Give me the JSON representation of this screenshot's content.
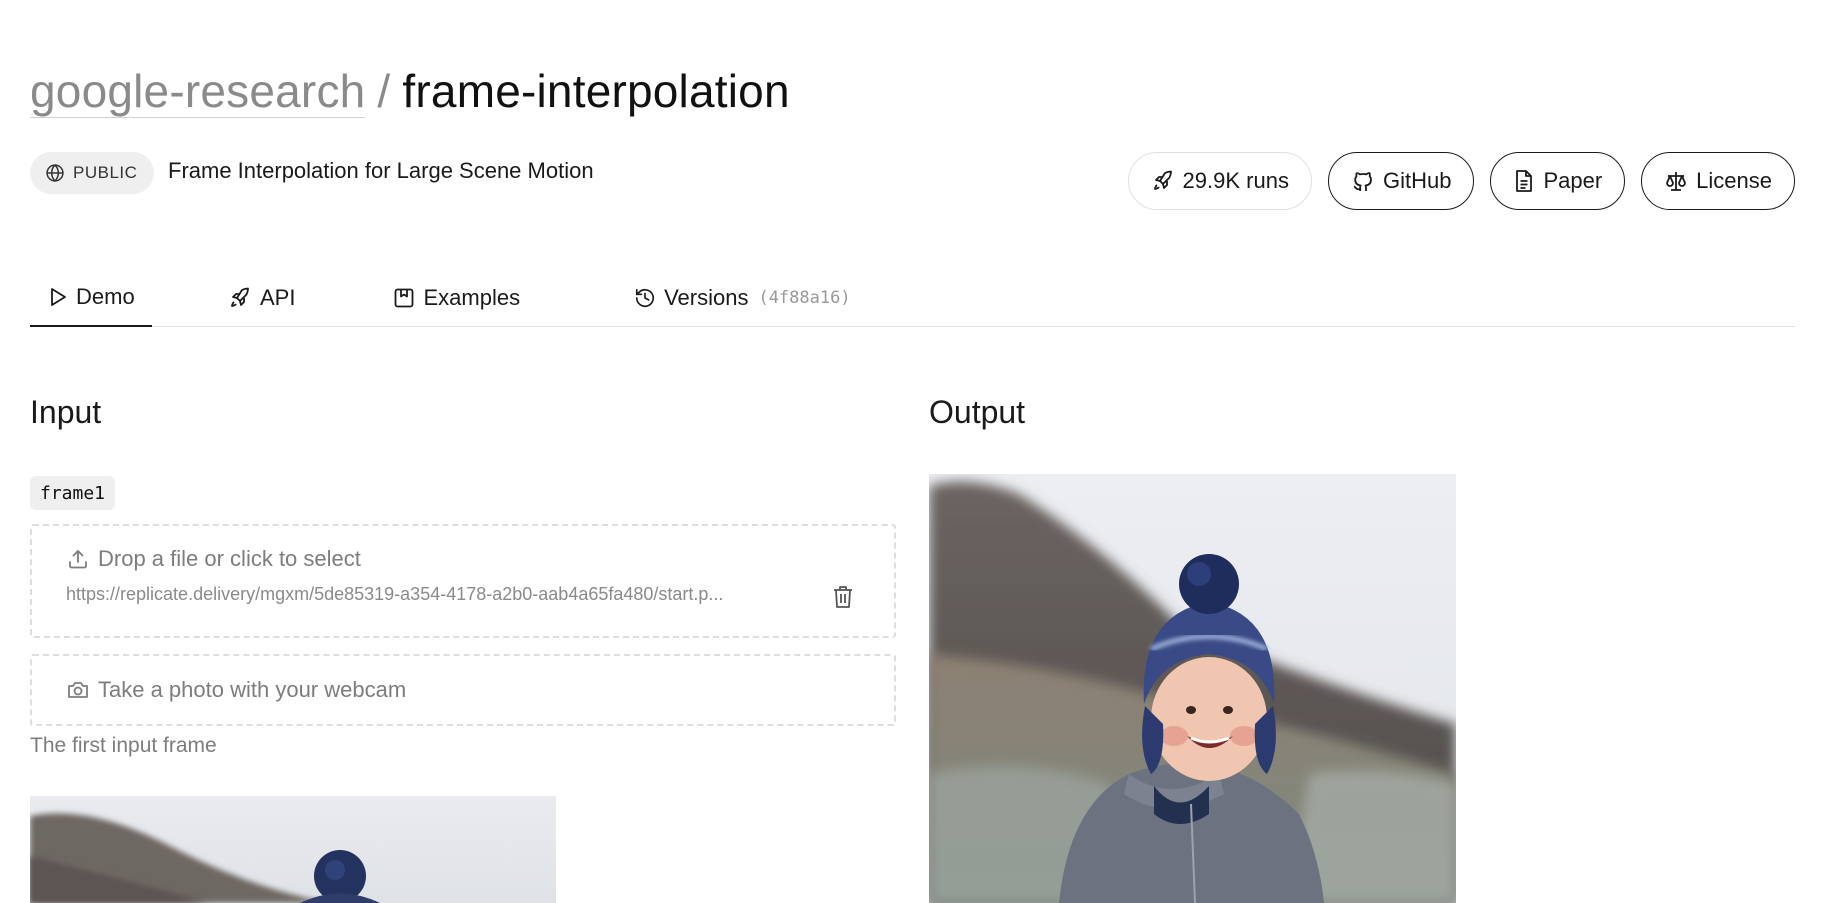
{
  "header": {
    "owner": "google-research",
    "separator": "/",
    "repo": "frame-interpolation"
  },
  "meta": {
    "visibility_badge": "PUBLIC",
    "description": "Frame Interpolation for Large Scene Motion"
  },
  "actions": {
    "runs_label": "29.9K runs",
    "github_label": "GitHub",
    "paper_label": "Paper",
    "license_label": "License"
  },
  "tabs": {
    "demo": "Demo",
    "api": "API",
    "examples": "Examples",
    "versions": "Versions",
    "version_hash": "(4f88a16)",
    "active": "Demo"
  },
  "input": {
    "heading": "Input",
    "field_name": "frame1",
    "drop_label": "Drop a file or click to select",
    "file_url": "https://replicate.delivery/mgxm/5de85319-a354-4178-a2b0-aab4a65fa480/start.p...",
    "webcam_label": "Take a photo with your webcam",
    "help_text": "The first input frame"
  },
  "output": {
    "heading": "Output"
  },
  "icons": {
    "globe": "globe-icon",
    "rocket": "rocket-icon",
    "github": "github-icon",
    "paper": "document-icon",
    "license": "scale-icon",
    "play": "play-icon",
    "examples": "bookmark-icon",
    "versions": "history-icon",
    "upload": "upload-icon",
    "trash": "trash-icon",
    "camera": "camera-icon"
  }
}
